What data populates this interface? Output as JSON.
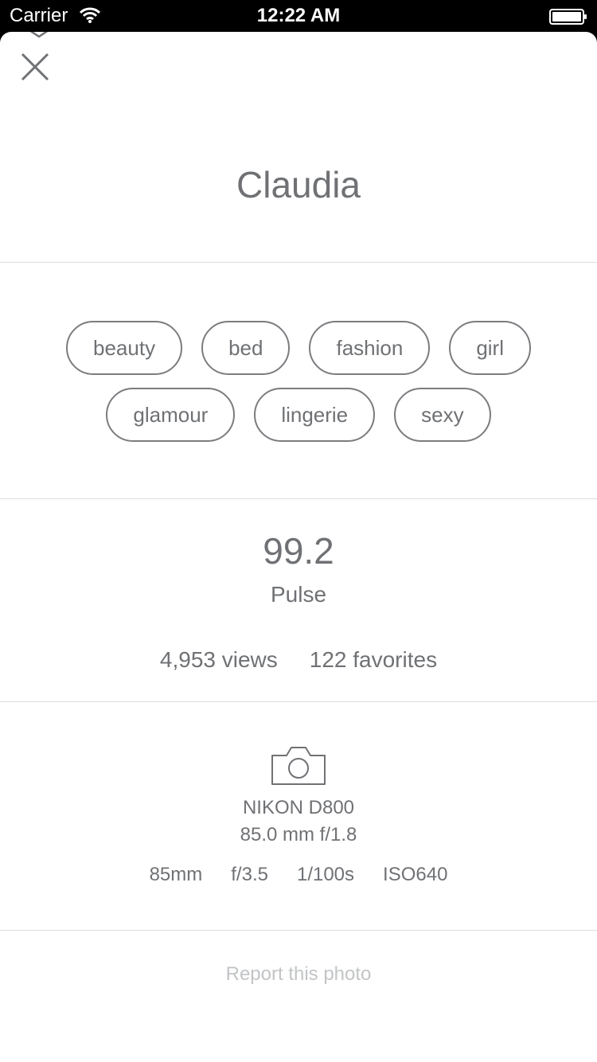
{
  "status_bar": {
    "carrier": "Carrier",
    "time": "12:22 AM",
    "icons": [
      "wifi-icon",
      "battery-icon"
    ]
  },
  "photo": {
    "title": "Claudia",
    "tags": [
      "beauty",
      "bed",
      "fashion",
      "girl",
      "glamour",
      "lingerie",
      "sexy"
    ],
    "pulse": {
      "value": "99.2",
      "label": "Pulse"
    },
    "views": "4,953 views",
    "favorites": "122 favorites"
  },
  "camera": {
    "icon": "camera-icon",
    "model": "NIKON D800",
    "lens": "85.0 mm f/1.8",
    "focal_length": "85mm",
    "aperture": "f/3.5",
    "shutter": "1/100s",
    "iso": "ISO640"
  },
  "report_label": "Report this photo",
  "colors": {
    "text": "#6f7174",
    "muted": "#c2c4c6",
    "divider": "#dcdcdc",
    "tag_border": "#7a7c7f"
  }
}
